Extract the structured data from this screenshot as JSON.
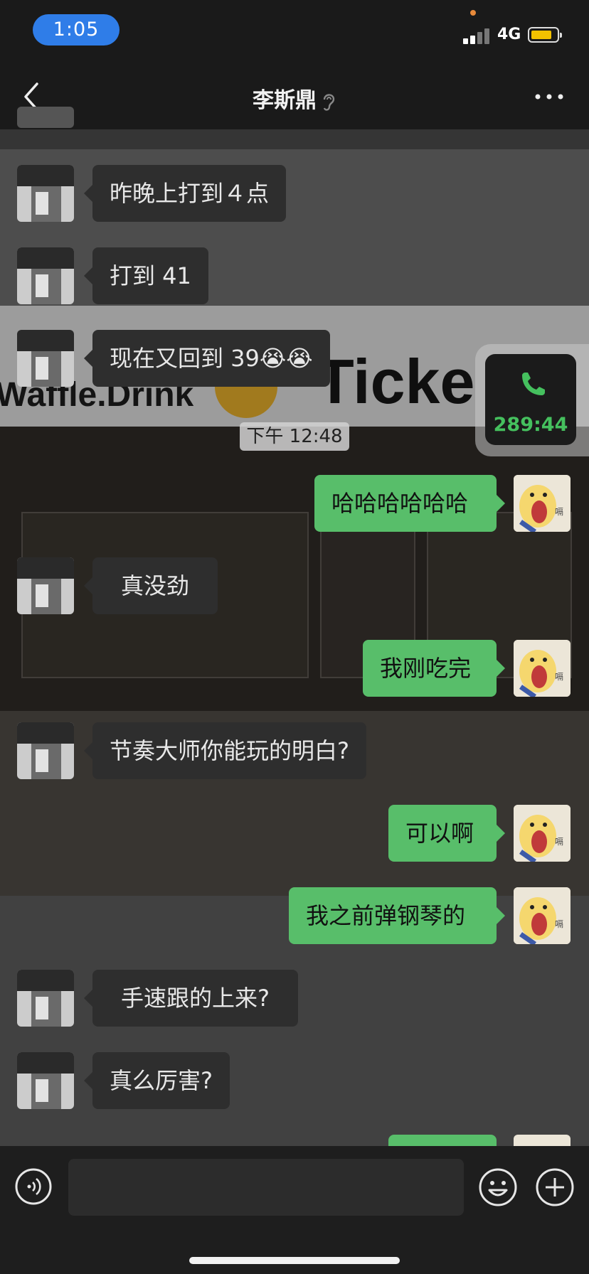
{
  "status_bar": {
    "time": "1:05",
    "network": "4G"
  },
  "nav": {
    "title": "李斯鼎"
  },
  "messages": [
    {
      "side": "left",
      "text": "昨晚上打到４点"
    },
    {
      "side": "left",
      "text": "打到 41"
    },
    {
      "side": "left",
      "text": "现在又回到 39😭😭"
    },
    {
      "side": "right",
      "text": "哈哈哈哈哈哈"
    },
    {
      "side": "left",
      "text": "真没劲"
    },
    {
      "side": "right",
      "text": "我刚吃完"
    },
    {
      "side": "left",
      "text": "节奏大师你能玩的明白?"
    },
    {
      "side": "right",
      "text": "可以啊"
    },
    {
      "side": "right",
      "text": "我之前弹钢琴的"
    },
    {
      "side": "left",
      "text": "手速跟的上来?"
    },
    {
      "side": "left",
      "text": "真么厉害?"
    }
  ],
  "timestamp": "下午 12:48",
  "call_float": {
    "duration": "289:44"
  },
  "background_sign": {
    "line1": "Waffle.Drink",
    "line2": "Ticke"
  },
  "sticker_caption": "嗝",
  "input": {
    "value": ""
  },
  "colors": {
    "accent_green": "#58be6a",
    "call_green": "#45c05e",
    "time_pill_blue": "#2f7de8"
  },
  "icons": [
    "back-icon",
    "ear-icon",
    "more-icon",
    "phone-icon",
    "voice-icon",
    "emoji-icon",
    "plus-icon"
  ]
}
